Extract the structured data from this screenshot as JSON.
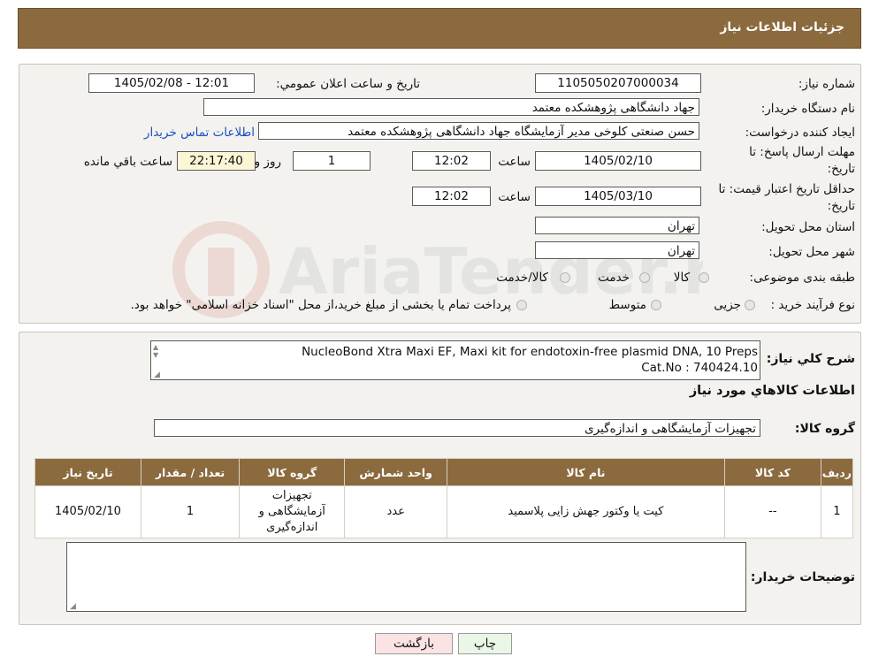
{
  "header": {
    "title": "جزئیات اطلاعات نیاز"
  },
  "form": {
    "need_number_label": "شماره نیاز:",
    "need_number": "1105050207000034",
    "announce_label": "تاریخ و ساعت اعلان عمومي:",
    "announce_value": "1405/02/08 - 12:01",
    "buyer_org_label": "نام دستگاه خريدار:",
    "buyer_org": "جهاد دانشگاهی پژوهشکده معتمد",
    "requester_label": "ايجاد کننده درخواست:",
    "requester": "حسن صنعتی کلوخی مدیر آزمایشگاه جهاد دانشگاهی پژوهشکده معتمد",
    "contact_link": "اطلاعات تماس خريدار",
    "deadline_label_1": "مهلت ارسال پاسخ: تا",
    "deadline_label_2": "تاريخ:",
    "deadline_date": "1405/02/10",
    "hour_label": "ساعت",
    "deadline_time": "12:02",
    "days_value": "1",
    "days_label": "روز و",
    "remaining_time": "22:17:40",
    "remaining_label": "ساعت باقي مانده",
    "validity_label_1": "حداقل تاريخ اعتبار قيمت: تا",
    "validity_label_2": "تاريخ:",
    "validity_date": "1405/03/10",
    "validity_time": "12:02",
    "province_label": "استان محل تحويل:",
    "province": "تهران",
    "city_label": "شهر محل تحويل:",
    "city": "تهران",
    "category_label": "طبقه بندی موضوعی:",
    "category_options": [
      "کالا",
      "خدمت",
      "کالا/خدمت"
    ],
    "process_label": "نوع فرآيند خريد :",
    "process_options": [
      "جزیی",
      "متوسط"
    ],
    "process_note": "پرداخت تمام يا بخشی از مبلغ خريد،از محل \"اسناد خزانه اسلامی\" خواهد بود."
  },
  "details": {
    "desc_label": "شرح کلي نياز:",
    "desc_line1": "NucleoBond Xtra Maxi EF, Maxi kit for endotoxin-free plasmid DNA, 10 Preps",
    "desc_line2": "Cat.No : 740424.10",
    "goods_info_title": "اطلاعات کالاهاي مورد نياز",
    "goods_group_label": "گروه کالا:",
    "goods_group": "تجهیزات آزمایشگاهی و اندازه‌گیری",
    "table": {
      "headers": [
        "رديف",
        "کد کالا",
        "نام کالا",
        "واحد شمارش",
        "گروه کالا",
        "تعداد / مقدار",
        "تاريخ نياز"
      ],
      "rows": [
        [
          "1",
          "--",
          "کیت یا وکتور جهش زایی پلاسمید",
          "عدد",
          "تجهیزات آزمایشگاهی و اندازه‌گیری",
          "1",
          "1405/02/10"
        ]
      ]
    },
    "buyer_notes_label": "توضيحات خريدار:"
  },
  "buttons": {
    "print": "چاپ",
    "back": "بازگشت"
  },
  "watermark": "AriaTender.neT"
}
